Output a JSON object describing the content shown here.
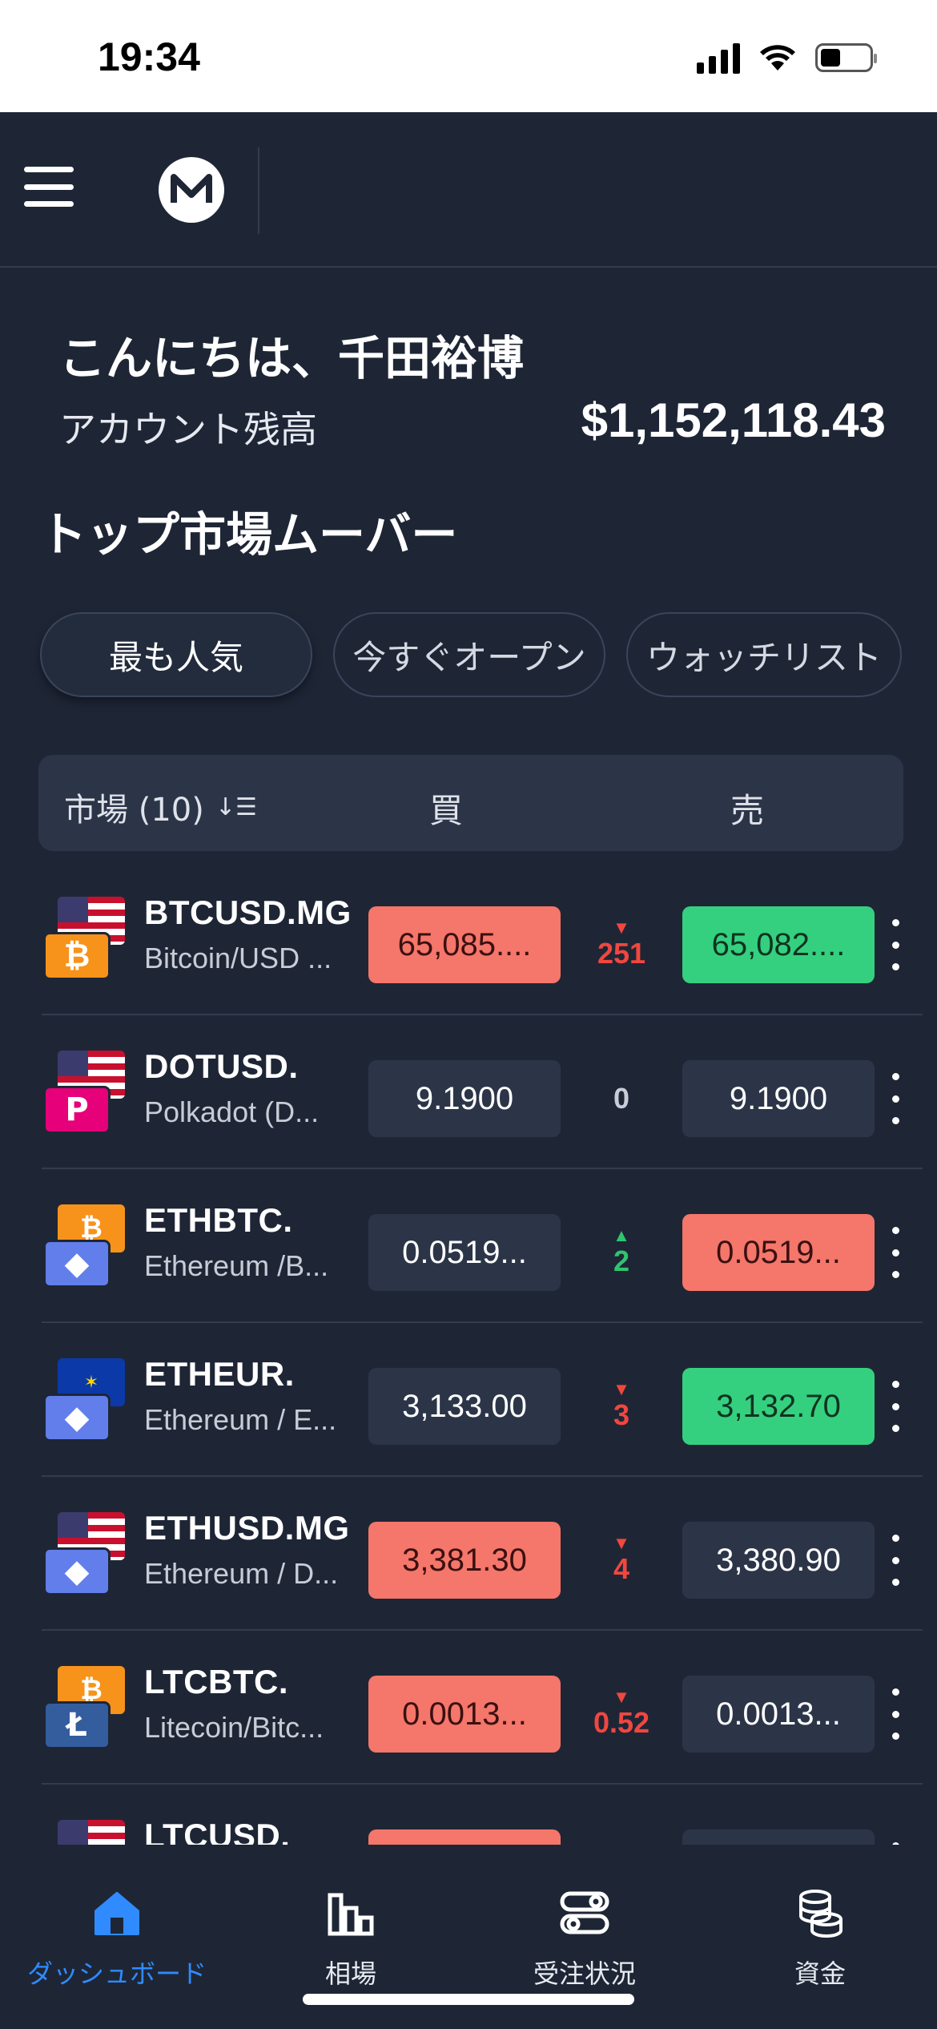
{
  "status_bar": {
    "time": "19:34"
  },
  "header": {
    "greeting": "こんにちは、千田裕博",
    "balance_label": "アカウント残高",
    "balance_value": "$1,152,118.43"
  },
  "section_title": "トップ市場ムーバー",
  "filters": [
    {
      "label": "最も人気",
      "active": true
    },
    {
      "label": "今すぐオープン",
      "active": false
    },
    {
      "label": "ウォッチリスト",
      "active": false
    }
  ],
  "table_header": {
    "market": "市場 (10)",
    "buy": "買",
    "sell": "売",
    "sort_icon": "↓☰"
  },
  "rows": [
    {
      "symbol": "BTCUSD.MG",
      "description": "Bitcoin/USD ...",
      "buy": "65,085....",
      "buy_color": "red",
      "spread": "251",
      "direction": "down",
      "sell": "65,082....",
      "sell_color": "green",
      "top_flag": "us",
      "coin": "btc",
      "coin_glyph": "₿"
    },
    {
      "symbol": "DOTUSD.",
      "description": "Polkadot (D...",
      "buy": "9.1900",
      "buy_color": "neutral",
      "spread": "0",
      "direction": "flat",
      "sell": "9.1900",
      "sell_color": "neutral",
      "top_flag": "us",
      "coin": "dot",
      "coin_glyph": "P"
    },
    {
      "symbol": "ETHBTC.",
      "description": "Ethereum /B...",
      "buy": "0.0519...",
      "buy_color": "neutral",
      "spread": "2",
      "direction": "up",
      "sell": "0.0519...",
      "sell_color": "red",
      "top_flag": "btc",
      "coin": "eth",
      "coin_glyph": "◆"
    },
    {
      "symbol": "ETHEUR.",
      "description": "Ethereum / E...",
      "buy": "3,133.00",
      "buy_color": "neutral",
      "spread": "3",
      "direction": "down",
      "sell": "3,132.70",
      "sell_color": "green",
      "top_flag": "eu",
      "coin": "eth",
      "coin_glyph": "◆"
    },
    {
      "symbol": "ETHUSD.MG",
      "description": "Ethereum / D...",
      "buy": "3,381.30",
      "buy_color": "red",
      "spread": "4",
      "direction": "down",
      "sell": "3,380.90",
      "sell_color": "neutral",
      "top_flag": "us",
      "coin": "eth",
      "coin_glyph": "◆"
    },
    {
      "symbol": "LTCBTC.",
      "description": "Litecoin/Bitc...",
      "buy": "0.0013...",
      "buy_color": "red",
      "spread": "0.52",
      "direction": "down",
      "sell": "0.0013...",
      "sell_color": "neutral",
      "top_flag": "btc",
      "coin": "ltc",
      "coin_glyph": "Ł"
    },
    {
      "symbol": "LTCUSD.",
      "description": "",
      "buy": "",
      "buy_color": "red",
      "spread": "",
      "direction": "down",
      "sell": "",
      "sell_color": "neutral",
      "top_flag": "us",
      "coin": "ltc",
      "coin_glyph": "Ł"
    }
  ],
  "bottom_nav": [
    {
      "label": "ダッシュボード",
      "icon": "home-icon",
      "active": true
    },
    {
      "label": "相場",
      "icon": "bar-chart-icon",
      "active": false
    },
    {
      "label": "受注状況",
      "icon": "toggle-list-icon",
      "active": false
    },
    {
      "label": "資金",
      "icon": "coins-icon",
      "active": false
    }
  ],
  "colors": {
    "background": "#1e2636",
    "red": "#f5766a",
    "green": "#34d07f",
    "accent": "#2f8bff"
  }
}
